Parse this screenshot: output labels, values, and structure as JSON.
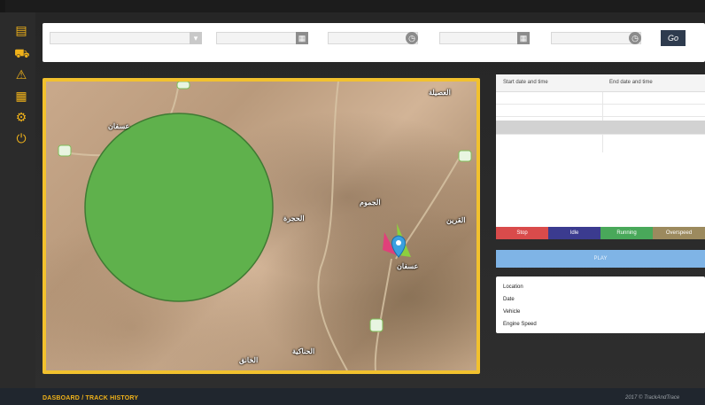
{
  "sidebar": {
    "icons": [
      "dashboard-icon",
      "fleet-icon",
      "alert-icon",
      "report-icon",
      "settings-icon",
      "power-icon"
    ],
    "glyphs": [
      "▤",
      "⛟",
      "⚠",
      "▦",
      "⚙",
      "⏻"
    ],
    "accent_color": "#f0b21a"
  },
  "filters": {
    "vehicle_select_value": "",
    "start_date_value": "",
    "start_time_value": "",
    "end_date_value": "",
    "end_time_value": "",
    "go_label": "Go"
  },
  "map": {
    "labels": [
      {
        "text": "عسفان"
      },
      {
        "text": "العصيلة"
      },
      {
        "text": "الجموم"
      },
      {
        "text": "الحجرة"
      },
      {
        "text": "القرين"
      },
      {
        "text": "عسفان"
      },
      {
        "text": "الحناكية"
      },
      {
        "text": "الخانق"
      }
    ],
    "geofence_color": "#5fb14c",
    "frame_color": "#f2c12e"
  },
  "history_table": {
    "columns": [
      "Start date and time",
      "End date and time"
    ]
  },
  "legend": [
    {
      "label": "Stop",
      "color": "#d94b4b"
    },
    {
      "label": "Idle",
      "color": "#3b3b8f"
    },
    {
      "label": "Running",
      "color": "#49a85a"
    },
    {
      "label": "Overspeed",
      "color": "#9c8a5e"
    }
  ],
  "play_label": "PLAY",
  "info_rows": [
    "Location",
    "Date",
    "Vehicle",
    "Engine Speed"
  ],
  "footer": {
    "breadcrumb": "DASBOARD / TRACK HISTORY",
    "copyright": "2017 © TrackAndTrace"
  }
}
